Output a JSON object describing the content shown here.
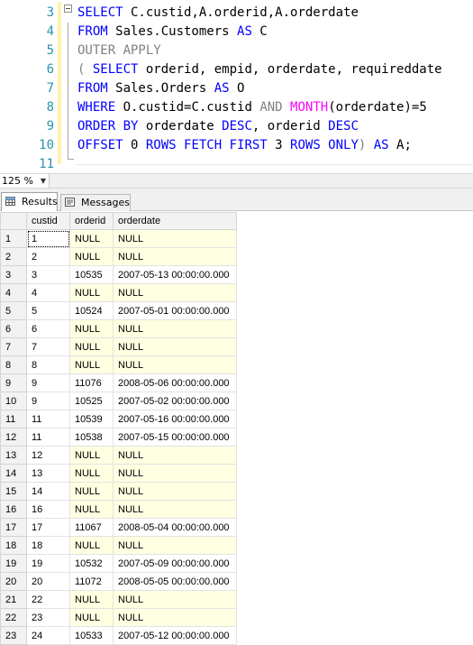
{
  "editor": {
    "lines": [
      {
        "num": "3",
        "parts": [
          {
            "t": "SELECT",
            "c": "kw"
          },
          {
            "t": " C.custid,A.orderid,A.orderdate",
            "c": "tx"
          }
        ]
      },
      {
        "num": "4",
        "parts": [
          {
            "t": "FROM",
            "c": "kw"
          },
          {
            "t": " Sales.Customers ",
            "c": "tx"
          },
          {
            "t": "AS",
            "c": "kw"
          },
          {
            "t": " C",
            "c": "tx"
          }
        ]
      },
      {
        "num": "5",
        "parts": [
          {
            "t": "OUTER APPLY",
            "c": "gr"
          }
        ]
      },
      {
        "num": "6",
        "parts": [
          {
            "t": "( ",
            "c": "gr"
          },
          {
            "t": "SELECT",
            "c": "kw"
          },
          {
            "t": " orderid, empid, orderdate, requireddate",
            "c": "tx"
          }
        ]
      },
      {
        "num": "7",
        "parts": [
          {
            "t": "FROM",
            "c": "kw"
          },
          {
            "t": " Sales.Orders ",
            "c": "tx"
          },
          {
            "t": "AS",
            "c": "kw"
          },
          {
            "t": " O",
            "c": "tx"
          }
        ]
      },
      {
        "num": "8",
        "parts": [
          {
            "t": "WHERE",
            "c": "kw"
          },
          {
            "t": " O.custid=C.custid ",
            "c": "tx"
          },
          {
            "t": "AND",
            "c": "gr"
          },
          {
            "t": " ",
            "c": "tx"
          },
          {
            "t": "MONTH",
            "c": "fn"
          },
          {
            "t": "(orderdate)=5",
            "c": "tx"
          }
        ]
      },
      {
        "num": "9",
        "parts": [
          {
            "t": "ORDER BY",
            "c": "kw"
          },
          {
            "t": " orderdate ",
            "c": "tx"
          },
          {
            "t": "DESC",
            "c": "kw"
          },
          {
            "t": ", orderid ",
            "c": "tx"
          },
          {
            "t": "DESC",
            "c": "kw"
          }
        ]
      },
      {
        "num": "10",
        "parts": [
          {
            "t": "OFFSET",
            "c": "kw"
          },
          {
            "t": " 0 ",
            "c": "tx"
          },
          {
            "t": "ROWS FETCH FIRST",
            "c": "kw"
          },
          {
            "t": " 3 ",
            "c": "tx"
          },
          {
            "t": "ROWS ONLY",
            "c": "kw"
          },
          {
            "t": ") ",
            "c": "gr"
          },
          {
            "t": "AS",
            "c": "kw"
          },
          {
            "t": " A;",
            "c": "tx"
          }
        ]
      },
      {
        "num": "11",
        "parts": []
      }
    ]
  },
  "zoom": {
    "value": "125 %"
  },
  "tabs": {
    "results": "Results",
    "messages": "Messages"
  },
  "grid": {
    "columns": [
      "custid",
      "orderid",
      "orderdate"
    ],
    "rows": [
      [
        "1",
        "1",
        "NULL",
        "NULL"
      ],
      [
        "2",
        "2",
        "NULL",
        "NULL"
      ],
      [
        "3",
        "3",
        "10535",
        "2007-05-13 00:00:00.000"
      ],
      [
        "4",
        "4",
        "NULL",
        "NULL"
      ],
      [
        "5",
        "5",
        "10524",
        "2007-05-01 00:00:00.000"
      ],
      [
        "6",
        "6",
        "NULL",
        "NULL"
      ],
      [
        "7",
        "7",
        "NULL",
        "NULL"
      ],
      [
        "8",
        "8",
        "NULL",
        "NULL"
      ],
      [
        "9",
        "9",
        "11076",
        "2008-05-06 00:00:00.000"
      ],
      [
        "10",
        "9",
        "10525",
        "2007-05-02 00:00:00.000"
      ],
      [
        "11",
        "11",
        "10539",
        "2007-05-16 00:00:00.000"
      ],
      [
        "12",
        "11",
        "10538",
        "2007-05-15 00:00:00.000"
      ],
      [
        "13",
        "12",
        "NULL",
        "NULL"
      ],
      [
        "14",
        "13",
        "NULL",
        "NULL"
      ],
      [
        "15",
        "14",
        "NULL",
        "NULL"
      ],
      [
        "16",
        "16",
        "NULL",
        "NULL"
      ],
      [
        "17",
        "17",
        "11067",
        "2008-05-04 00:00:00.000"
      ],
      [
        "18",
        "18",
        "NULL",
        "NULL"
      ],
      [
        "19",
        "19",
        "10532",
        "2007-05-09 00:00:00.000"
      ],
      [
        "20",
        "20",
        "11072",
        "2008-05-05 00:00:00.000"
      ],
      [
        "21",
        "22",
        "NULL",
        "NULL"
      ],
      [
        "22",
        "23",
        "NULL",
        "NULL"
      ],
      [
        "23",
        "24",
        "10533",
        "2007-05-12 00:00:00.000"
      ]
    ]
  }
}
